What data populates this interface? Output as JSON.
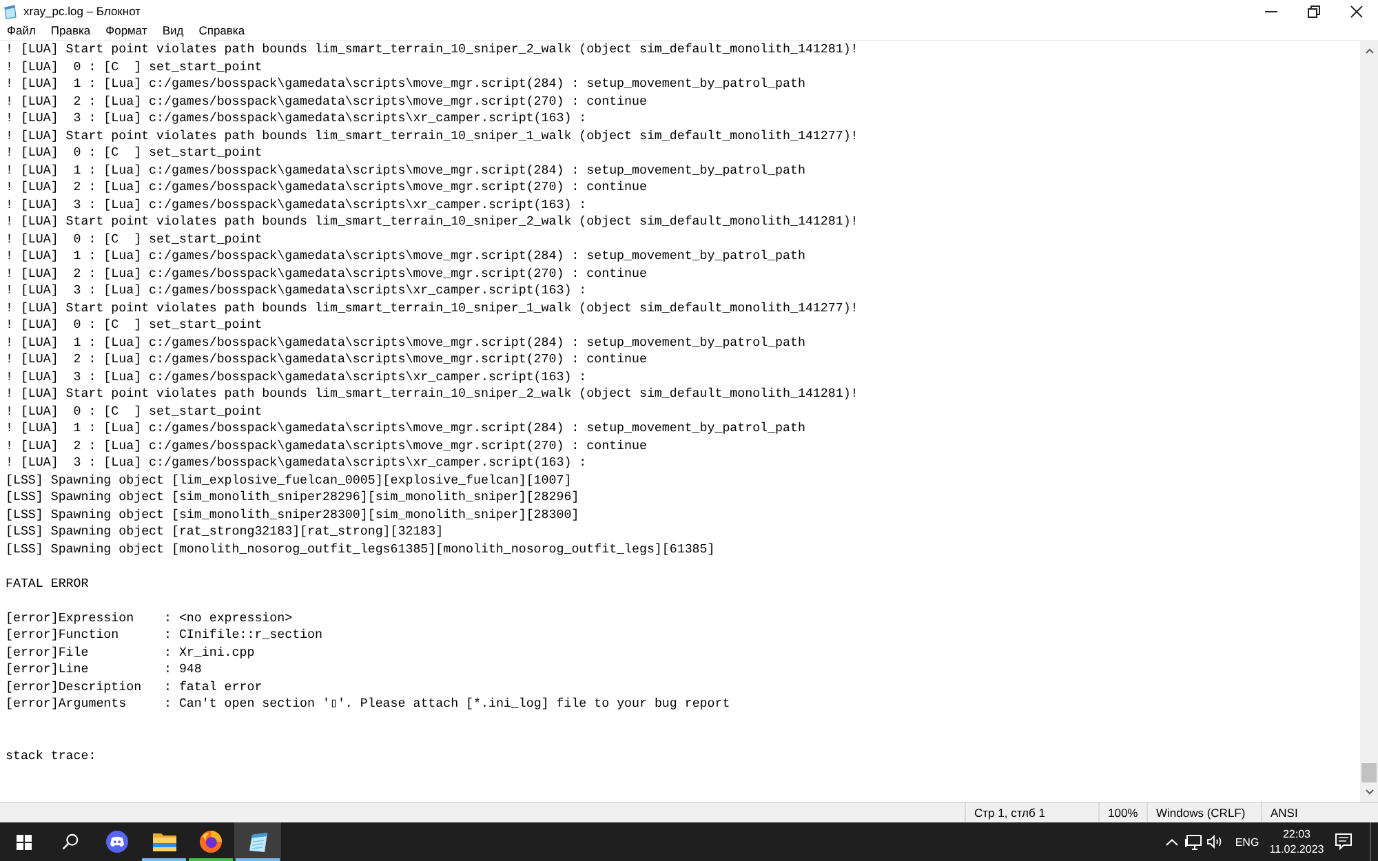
{
  "window": {
    "title": "xray_pc.log – Блокнот"
  },
  "menu": [
    "Файл",
    "Правка",
    "Формат",
    "Вид",
    "Справка"
  ],
  "document": {
    "sections": [
      {
        "kind": "log",
        "lines": [
          "! [LUA] Start point violates path bounds lim_smart_terrain_10_sniper_2_walk (object sim_default_monolith_141281)!",
          "! [LUA]  0 : [C  ] set_start_point",
          "! [LUA]  1 : [Lua] c:/games/bosspack\\gamedata\\scripts\\move_mgr.script(284) : setup_movement_by_patrol_path",
          "! [LUA]  2 : [Lua] c:/games/bosspack\\gamedata\\scripts\\move_mgr.script(270) : continue",
          "! [LUA]  3 : [Lua] c:/games/bosspack\\gamedata\\scripts\\xr_camper.script(163) :",
          "! [LUA] Start point violates path bounds lim_smart_terrain_10_sniper_1_walk (object sim_default_monolith_141277)!",
          "! [LUA]  0 : [C  ] set_start_point",
          "! [LUA]  1 : [Lua] c:/games/bosspack\\gamedata\\scripts\\move_mgr.script(284) : setup_movement_by_patrol_path",
          "! [LUA]  2 : [Lua] c:/games/bosspack\\gamedata\\scripts\\move_mgr.script(270) : continue",
          "! [LUA]  3 : [Lua] c:/games/bosspack\\gamedata\\scripts\\xr_camper.script(163) :",
          "! [LUA] Start point violates path bounds lim_smart_terrain_10_sniper_2_walk (object sim_default_monolith_141281)!",
          "! [LUA]  0 : [C  ] set_start_point",
          "! [LUA]  1 : [Lua] c:/games/bosspack\\gamedata\\scripts\\move_mgr.script(284) : setup_movement_by_patrol_path",
          "! [LUA]  2 : [Lua] c:/games/bosspack\\gamedata\\scripts\\move_mgr.script(270) : continue",
          "! [LUA]  3 : [Lua] c:/games/bosspack\\gamedata\\scripts\\xr_camper.script(163) :",
          "! [LUA] Start point violates path bounds lim_smart_terrain_10_sniper_1_walk (object sim_default_monolith_141277)!",
          "! [LUA]  0 : [C  ] set_start_point",
          "! [LUA]  1 : [Lua] c:/games/bosspack\\gamedata\\scripts\\move_mgr.script(284) : setup_movement_by_patrol_path",
          "! [LUA]  2 : [Lua] c:/games/bosspack\\gamedata\\scripts\\move_mgr.script(270) : continue",
          "! [LUA]  3 : [Lua] c:/games/bosspack\\gamedata\\scripts\\xr_camper.script(163) :",
          "! [LUA] Start point violates path bounds lim_smart_terrain_10_sniper_2_walk (object sim_default_monolith_141281)!",
          "! [LUA]  0 : [C  ] set_start_point",
          "! [LUA]  1 : [Lua] c:/games/bosspack\\gamedata\\scripts\\move_mgr.script(284) : setup_movement_by_patrol_path",
          "! [LUA]  2 : [Lua] c:/games/bosspack\\gamedata\\scripts\\move_mgr.script(270) : continue",
          "! [LUA]  3 : [Lua] c:/games/bosspack\\gamedata\\scripts\\xr_camper.script(163) :",
          "[LSS] Spawning object [lim_explosive_fuelcan_0005][explosive_fuelcan][1007]",
          "[LSS] Spawning object [sim_monolith_sniper28296][sim_monolith_sniper][28296]",
          "[LSS] Spawning object [sim_monolith_sniper28300][sim_monolith_sniper][28300]",
          "[LSS] Spawning object [rat_strong32183][rat_strong][32183]",
          "[LSS] Spawning object [monolith_nosorog_outfit_legs61385][monolith_nosorog_outfit_legs][61385]"
        ]
      },
      {
        "kind": "heading",
        "lines": [
          "FATAL ERROR"
        ]
      },
      {
        "kind": "fields",
        "lines": [
          "[error]Expression    : <no expression>",
          "[error]Function      : CInifile::r_section",
          "[error]File          : Xr_ini.cpp",
          "[error]Line          : 948",
          "[error]Description   : fatal error",
          "[error]Arguments     : Can't open section '▯'. Please attach [*.ini_log] file to your bug report"
        ]
      },
      {
        "kind": "trace",
        "lines": [
          "stack trace:"
        ]
      }
    ]
  },
  "status_bar": {
    "position": "Стр 1, стлб 1",
    "zoom": "100%",
    "line_endings": "Windows (CRLF)",
    "encoding": "ANSI"
  },
  "taskbar": {
    "apps": [
      {
        "kind": "chat",
        "running": false,
        "active": false
      },
      {
        "kind": "files",
        "running": true,
        "active": false,
        "color": "#76b9ed"
      },
      {
        "kind": "browser",
        "running": true,
        "active": false,
        "color": "#3fc43f"
      },
      {
        "kind": "editor",
        "running": true,
        "active": true,
        "color": "#76b9ed"
      }
    ],
    "tray": {
      "language": "ENG",
      "time": "22:03",
      "date": "11.02.2023"
    }
  }
}
